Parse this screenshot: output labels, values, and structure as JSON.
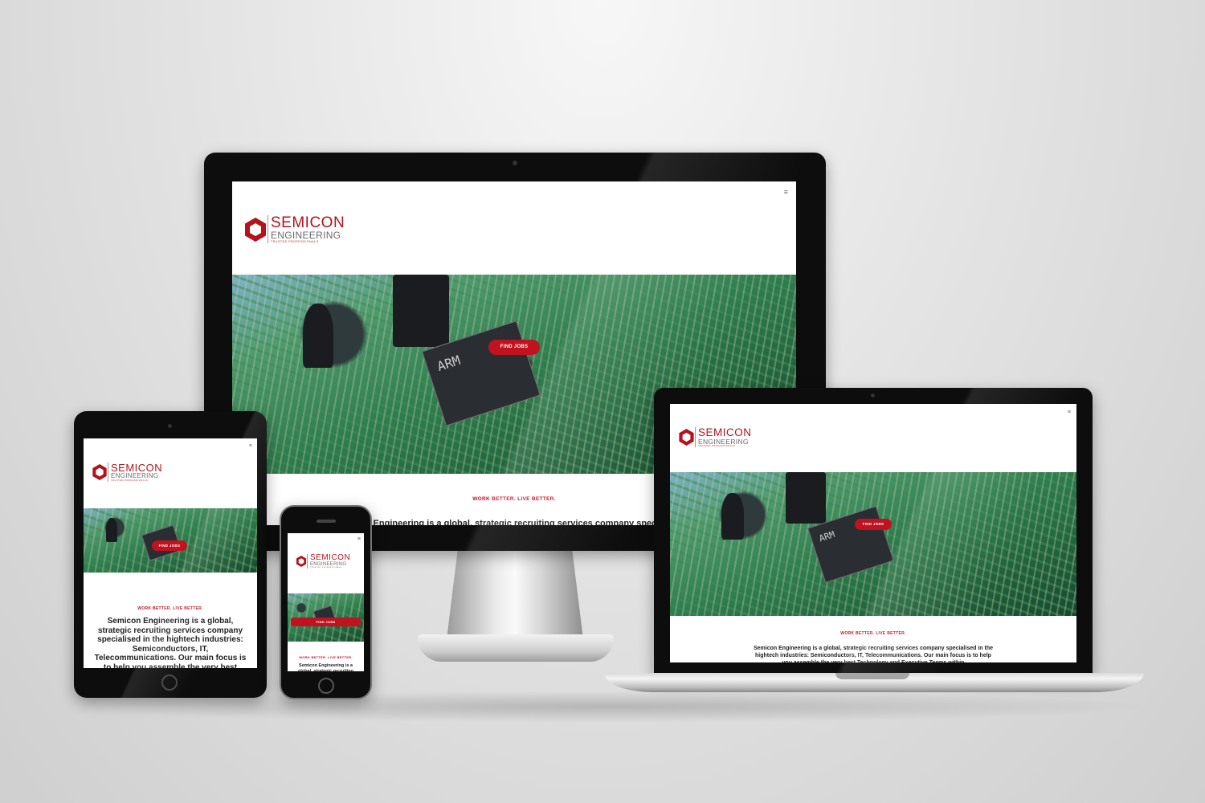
{
  "site": {
    "logo_top": "SEMICON",
    "logo_bottom": "ENGINEERING",
    "logo_tagline": "TRUSTED PROFESSIONALS",
    "cta_label": "FIND JOBS",
    "tagline": "WORK BETTER. LIVE BETTER.",
    "menu_icon": "hamburger-icon",
    "chip_marking": "ARM",
    "description": "Semicon Engineering is a global, strategic recruiting services company specialised in the hightech industries: Semiconductors, IT, Telecommunications. Our main focus is to help you assemble the very best Technology and Executive Teams within",
    "colors": {
      "brand_red": "#c0121f",
      "logo_grey": "#6a6a6a"
    }
  },
  "devices": [
    "desktop-monitor",
    "laptop",
    "tablet",
    "phone"
  ]
}
